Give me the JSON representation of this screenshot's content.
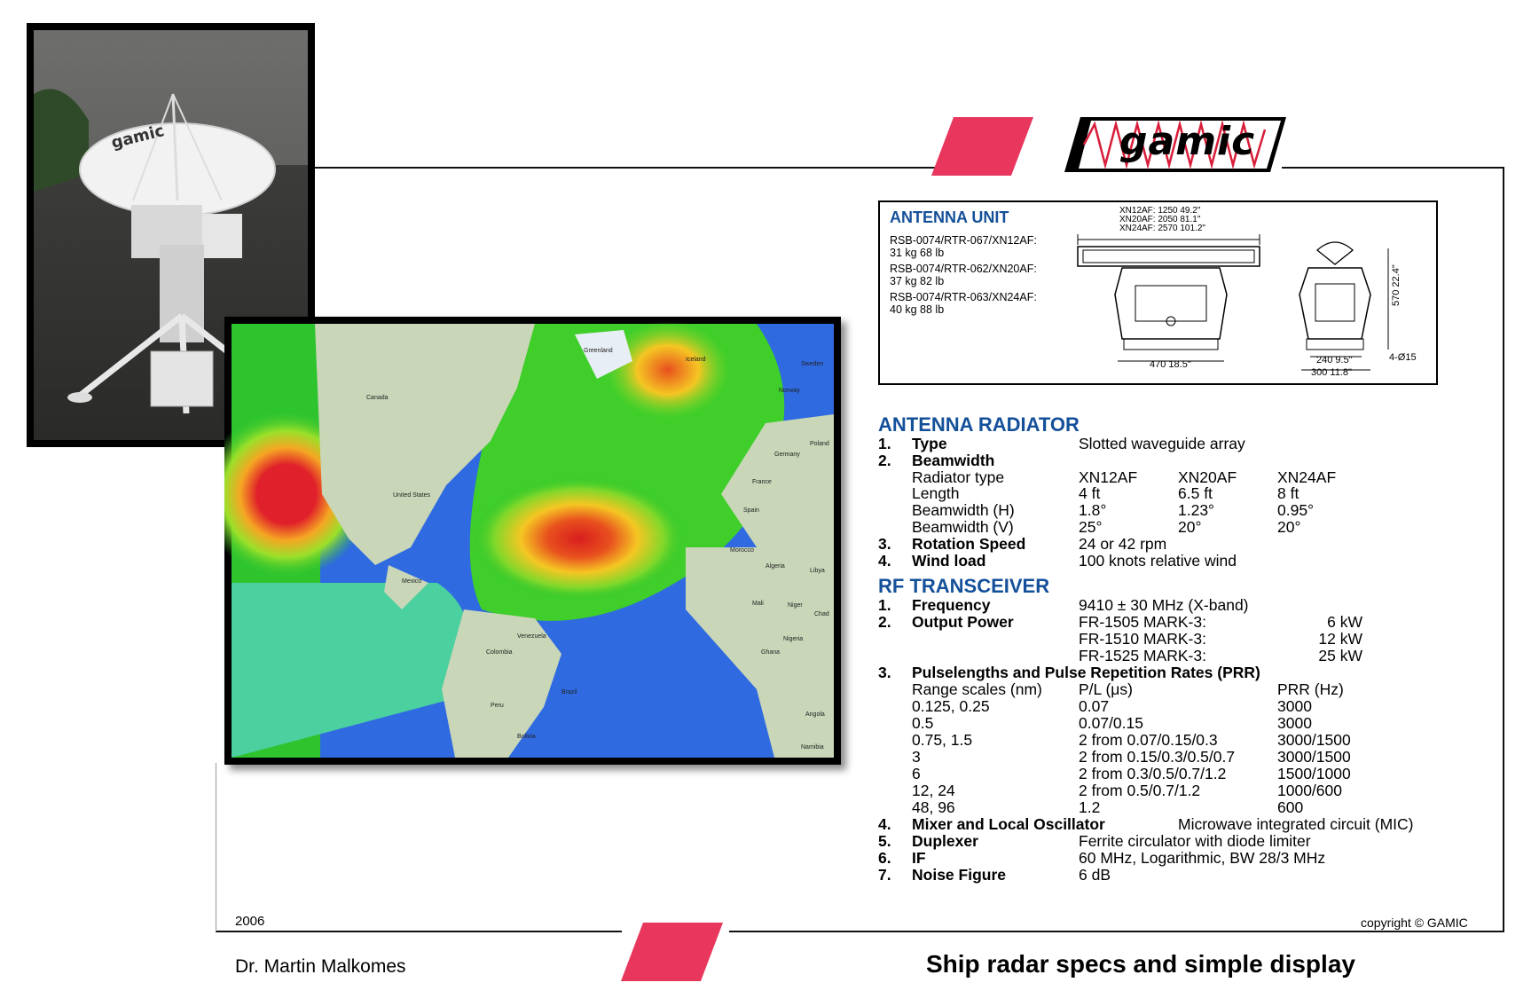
{
  "logo": {
    "text": "gamic"
  },
  "photo": {
    "dish_label": "gamic"
  },
  "map": {
    "labels": [
      "Greenland",
      "Iceland",
      "Canada",
      "Sweden",
      "Norway",
      "Poland",
      "Germany",
      "France",
      "Spain",
      "United States",
      "Mexico",
      "Morocco",
      "Algeria",
      "Libya",
      "Mali",
      "Niger",
      "Chad",
      "Venezuela",
      "Colombia",
      "Peru",
      "Brazil",
      "Bolivia",
      "Angola",
      "Namibia",
      "Nigeria",
      "Ghana"
    ]
  },
  "antenna_unit": {
    "title": "ANTENNA UNIT",
    "models": [
      {
        "line1": "RSB-0074/RTR-067/XN12AF:",
        "line2": "31 kg 68 lb"
      },
      {
        "line1": "RSB-0074/RTR-062/XN20AF:",
        "line2": "37 kg 82 lb"
      },
      {
        "line1": "RSB-0074/RTR-063/XN24AF:",
        "line2": "40 kg 88 lb"
      }
    ],
    "dims_top": [
      "XN12AF: 1250   49.2\"",
      "XN20AF: 2050   81.1\"",
      "XN24AF: 2570   101.2\""
    ],
    "dim_width": "470  18.5\"",
    "dim_height": "570  22.4\"",
    "dim_base1": "240  9.5\"",
    "dim_base2": "300  11.8\"",
    "dim_holes": "4-Ø15"
  },
  "radiator": {
    "title": "ANTENNA RADIATOR",
    "type_num": "1.",
    "type_label": "Type",
    "type_value": "Slotted waveguide array",
    "bw_num": "2.",
    "bw_label": "Beamwidth",
    "table": [
      [
        "Radiator type",
        "XN12AF",
        "XN20AF",
        "XN24AF"
      ],
      [
        "Length",
        "4 ft",
        "6.5 ft",
        "8 ft"
      ],
      [
        "Beamwidth (H)",
        "1.8°",
        "1.23°",
        "0.95°"
      ],
      [
        "Beamwidth (V)",
        "25°",
        "20°",
        "20°"
      ]
    ],
    "rot_num": "3.",
    "rot_label": "Rotation Speed",
    "rot_value": "24 or 42 rpm",
    "wind_num": "4.",
    "wind_label": "Wind load",
    "wind_value": "100 knots relative wind"
  },
  "transceiver": {
    "title": "RF TRANSCEIVER",
    "freq_num": "1.",
    "freq_label": "Frequency",
    "freq_value": "9410 ± 30 MHz (X-band)",
    "power_num": "2.",
    "power_label": "Output Power",
    "power": [
      [
        "FR-1505 MARK-3:",
        "6 kW"
      ],
      [
        "FR-1510 MARK-3:",
        "12 kW"
      ],
      [
        "FR-1525 MARK-3:",
        "25 kW"
      ]
    ],
    "prr_num": "3.",
    "prr_label": "Pulselengths and Pulse Repetition Rates (PRR)",
    "prr_table": [
      [
        "Range scales (nm)",
        "P/L (μs)",
        "PRR (Hz)"
      ],
      [
        "0.125, 0.25",
        "0.07",
        "3000"
      ],
      [
        "0.5",
        "0.07/0.15",
        "3000"
      ],
      [
        "0.75, 1.5",
        "2 from 0.07/0.15/0.3",
        "3000/1500"
      ],
      [
        "3",
        "2 from 0.15/0.3/0.5/0.7",
        "3000/1500"
      ],
      [
        "6",
        "2 from 0.3/0.5/0.7/1.2",
        "1500/1000"
      ],
      [
        "12, 24",
        "2 from 0.5/0.7/1.2",
        "1000/600"
      ],
      [
        "48, 96",
        "1.2",
        "600"
      ]
    ],
    "mixer_num": "4.",
    "mixer_label": "Mixer and Local Oscillator",
    "mixer_value": "Microwave integrated circuit (MIC)",
    "dup_num": "5.",
    "dup_label": "Duplexer",
    "dup_value": "Ferrite circulator with diode limiter",
    "if_num": "6.",
    "if_label": "IF",
    "if_value": "60 MHz, Logarithmic, BW 28/3 MHz",
    "noise_num": "7.",
    "noise_label": "Noise Figure",
    "noise_value": "6 dB"
  },
  "footer": {
    "year": "2006",
    "copyright": "copyright © GAMIC",
    "author": "Dr. Martin Malkomes",
    "caption": "Ship radar specs and simple display"
  },
  "colors": {
    "accent": "#e8365d",
    "heading": "#14509a"
  }
}
